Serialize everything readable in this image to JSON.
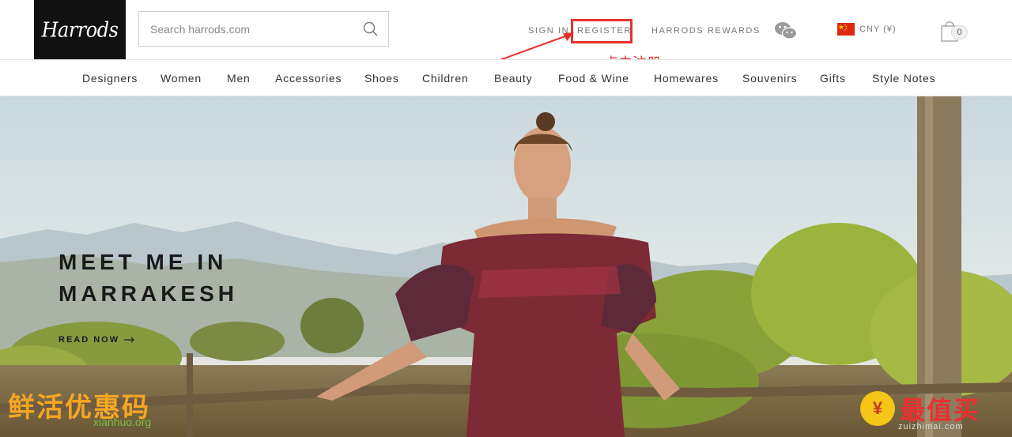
{
  "brand": {
    "logo_text": "Harrods"
  },
  "search": {
    "placeholder": "Search harrods.com"
  },
  "utility": {
    "sign_in": "SIGN IN",
    "register": "REGISTER",
    "rewards": "HARRODS REWARDS",
    "currency": "CNY (¥)",
    "bag_count": "0"
  },
  "annotation": {
    "text": "点击注册"
  },
  "nav": {
    "items": [
      {
        "label": "Designers"
      },
      {
        "label": "Women"
      },
      {
        "label": "Men"
      },
      {
        "label": "Accessories"
      },
      {
        "label": "Shoes"
      },
      {
        "label": "Children"
      },
      {
        "label": "Beauty"
      },
      {
        "label": "Food & Wine"
      },
      {
        "label": "Homewares"
      },
      {
        "label": "Souvenirs"
      },
      {
        "label": "Gifts"
      },
      {
        "label": "Style Notes"
      }
    ]
  },
  "hero": {
    "title": "MEET ME IN\nMARRAKESH",
    "cta": "READ NOW"
  },
  "watermarks": {
    "left_text": "鲜活优惠码",
    "left_url": "xianhuo.org",
    "right_text": "最值买",
    "right_url": "zuizhimai.com"
  },
  "colors": {
    "annotation_red": "#e8312f",
    "logo_bg": "#111111"
  }
}
